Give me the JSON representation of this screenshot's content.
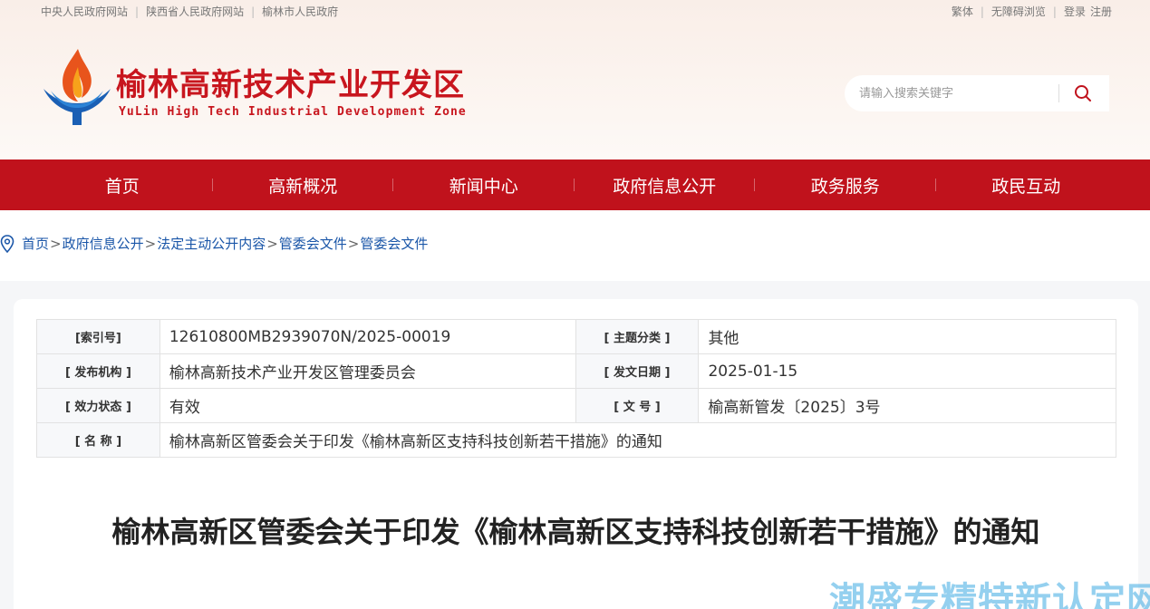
{
  "top_links": {
    "left": [
      "中央人民政府网站",
      "陕西省人民政府网站",
      "榆林市人民政府"
    ],
    "traditional": "繁体",
    "accessible": "无障碍浏览",
    "login": "登录",
    "register": "注册"
  },
  "brand": {
    "name_cn": "榆林高新技术产业开发区",
    "name_en": "YuLin High Tech Industrial Development Zone"
  },
  "search": {
    "placeholder": "请输入搜索关键字",
    "icon": "search-icon"
  },
  "nav": [
    "首页",
    "高新概况",
    "新闻中心",
    "政府信息公开",
    "政务服务",
    "政民互动"
  ],
  "breadcrumb": [
    "首页",
    "政府信息公开",
    "法定主动公开内容",
    "管委会文件",
    "管委会文件"
  ],
  "meta": {
    "index_label": "[索引号]",
    "index_value": "12610800MB2939070N/2025-00019",
    "category_label": "[ 主题分类 ]",
    "category_value": "其他",
    "publisher_label": "[ 发布机构 ]",
    "publisher_value": "榆林高新技术产业开发区管理委员会",
    "date_label": "[ 发文日期 ]",
    "date_value": "2025-01-15",
    "status_label": "[ 效力状态 ]",
    "status_value": "有效",
    "docno_label": "[ 文 号 ]",
    "docno_value": "榆高新管发〔2025〕3号",
    "name_label": "[ 名 称 ]",
    "name_value": "榆林高新区管委会关于印发《榆林高新区支持科技创新若干措施》的通知"
  },
  "document": {
    "title": "榆林高新区管委会关于印发《榆林高新区支持科技创新若干措施》的通知"
  },
  "watermark": "潮盛专精特新认定网",
  "colors": {
    "brand_red": "#c0121c",
    "link_blue": "#1a56a8"
  }
}
